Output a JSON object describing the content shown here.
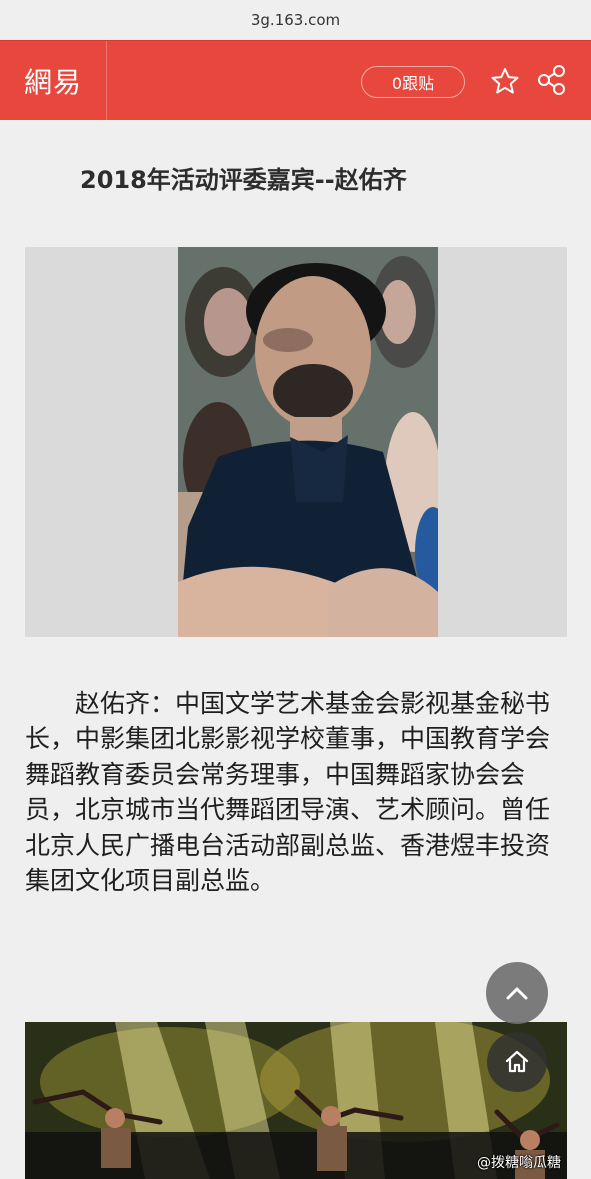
{
  "browser": {
    "url": "3g.163.com"
  },
  "header": {
    "logo_text": "網易",
    "follow_label": "0跟贴",
    "colors": {
      "background": "#e8473d",
      "foreground": "#ffffff"
    },
    "icons": [
      "star-icon",
      "share-icon"
    ]
  },
  "article": {
    "title": "2018年活动评委嘉宾--赵佑齐",
    "body": "赵佑齐：中国文学艺术基金会影视基金秘书长，中影集团北影影视学校董事，中国教育学会舞蹈教育委员会常务理事，中国舞蹈家协会会员，北京城市当代舞蹈团导演、艺术顾问。曾任北京人民广播电台活动部副总监、香港煜丰投资集团文化项目副总监。"
  },
  "controls": {
    "back_to_top_icon": "chevron-up-icon",
    "home_icon": "home-icon"
  },
  "watermark": "@拨糖嗡瓜糖"
}
